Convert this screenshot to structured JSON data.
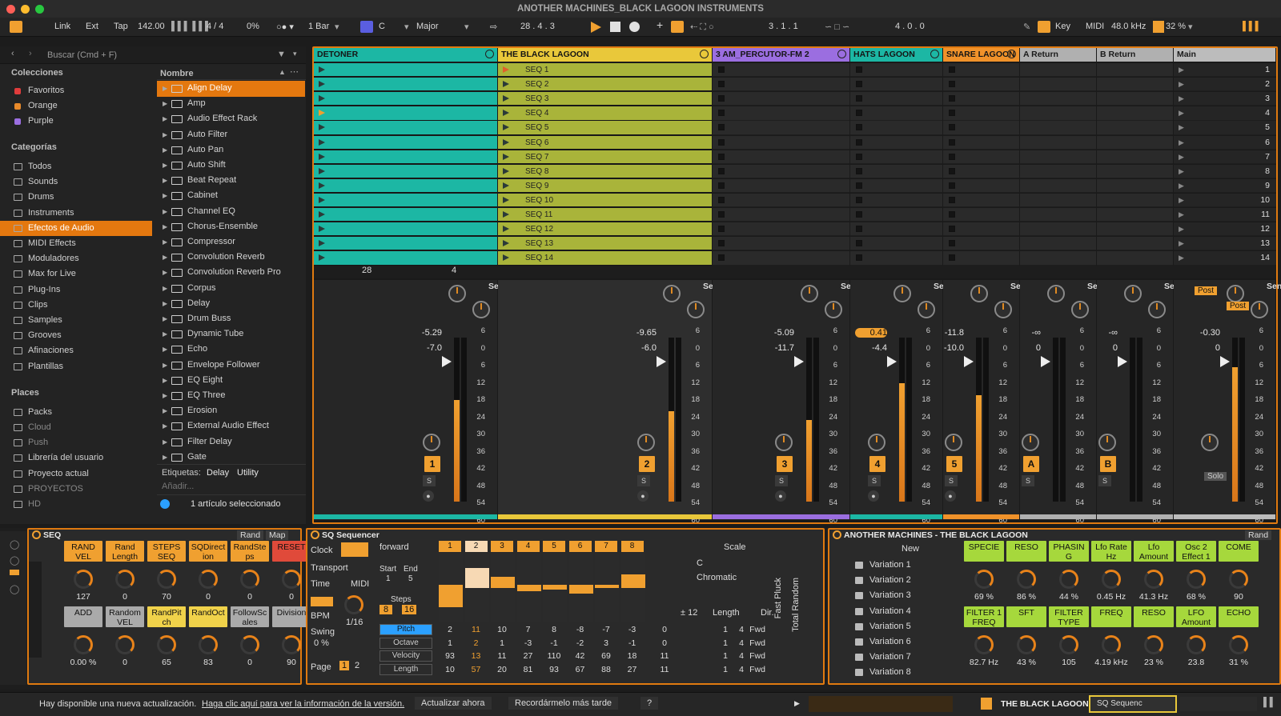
{
  "window_title": "ANOTHER MACHINES_BLACK LAGOON INSTRUMENTS",
  "transport": {
    "link": "Link",
    "ext": "Ext",
    "tap": "Tap",
    "bpm": "142.00",
    "sig": "4 / 4",
    "groove": "0%",
    "quant": "1 Bar",
    "key": "C",
    "scale": "Major",
    "position": "28 .  4 .  3",
    "loop_start": "3 .  1 .  1",
    "loop_len": "4 .  0 .  0",
    "key_label": "Key",
    "midi_label": "MIDI",
    "rate": "48.0 kHz",
    "cpu": "32 %"
  },
  "browser": {
    "search_placeholder": "Buscar (Cmd + F)",
    "collections_title": "Colecciones",
    "collections": [
      {
        "label": "Favoritos",
        "color": "#e03c3c"
      },
      {
        "label": "Orange",
        "color": "#e88a2a"
      },
      {
        "label": "Purple",
        "color": "#9b6ee0"
      }
    ],
    "categories_title": "Categorías",
    "categories": [
      "Todos",
      "Sounds",
      "Drums",
      "Instruments",
      "Efectos de Audio",
      "MIDI Effects",
      "Moduladores",
      "Max for Live",
      "Plug-Ins",
      "Clips",
      "Samples",
      "Grooves",
      "Afinaciones",
      "Plantillas"
    ],
    "places_title": "Places",
    "places": [
      "Packs",
      "Cloud",
      "Push",
      "Librería del usuario",
      "Proyecto actual",
      "PROYECTOS",
      "HD"
    ],
    "name_header": "Nombre",
    "devices": [
      "Align Delay",
      "Amp",
      "Audio Effect Rack",
      "Auto Filter",
      "Auto Pan",
      "Auto Shift",
      "Beat Repeat",
      "Cabinet",
      "Channel EQ",
      "Chorus-Ensemble",
      "Compressor",
      "Convolution Reverb",
      "Convolution Reverb Pro",
      "Corpus",
      "Delay",
      "Drum Buss",
      "Dynamic Tube",
      "Echo",
      "Envelope Follower",
      "EQ Eight",
      "EQ Three",
      "Erosion",
      "External Audio Effect",
      "Filter Delay",
      "Gate"
    ],
    "tags_label": "Etiquetas:",
    "tags": [
      "Delay",
      "Utility"
    ],
    "add_label": "Añadir...",
    "selected_count": "1 artículo seleccionado"
  },
  "tracks": [
    {
      "name": "DETONER",
      "color": "#1cb7a4",
      "vol": "-5.29",
      "vol2": "-7.0",
      "num": "1",
      "meter": 0.62
    },
    {
      "name": "THE BLACK LAGOON",
      "color": "#e9c83a",
      "vol": "-9.65",
      "vol2": "-6.0",
      "num": "2",
      "meter": 0.55
    },
    {
      "name": "3 AM_PERCUTOR-FM 2",
      "color": "#9b6ee0",
      "vol": "-5.09",
      "vol2": "-11.7",
      "num": "3",
      "meter": 0.5
    },
    {
      "name": "HATS LAGOON",
      "color": "#1cb7a4",
      "vol": "0.41",
      "vol2": "-4.4",
      "num": "4",
      "meter": 0.72
    },
    {
      "name": "SNARE LAGOON",
      "color": "#f0922a",
      "vol": "-11.8",
      "vol2": "-10.0",
      "num": "5",
      "meter": 0.65
    },
    {
      "name": "A Return",
      "color": "#b0b0b0",
      "vol": "-∞",
      "vol2": "0",
      "num": "A",
      "meter": 0
    },
    {
      "name": "B Return",
      "color": "#b0b0b0",
      "vol": "-∞",
      "vol2": "0",
      "num": "B",
      "meter": 0
    },
    {
      "name": "Main",
      "color": "#bcbcbc",
      "vol": "-0.30",
      "vol2": "0",
      "num": "",
      "meter": 0.82
    }
  ],
  "clips": [
    "SEQ 1",
    "SEQ 2",
    "SEQ 3",
    "SEQ 4",
    "SEQ 5",
    "SEQ 6",
    "SEQ 7",
    "SEQ 8",
    "SEQ 9",
    "SEQ 10",
    "SEQ 11",
    "SEQ 12",
    "SEQ 13",
    "SEQ 14"
  ],
  "scenes": [
    "1",
    "2",
    "3",
    "4",
    "5",
    "6",
    "7",
    "8",
    "9",
    "10",
    "11",
    "12",
    "13",
    "14"
  ],
  "sends_label": "Sends",
  "post_label": "Post",
  "solo_label": "Solo",
  "status1": {
    "a": "28",
    "b": "4"
  },
  "meter_scale": [
    "6",
    "0",
    "6",
    "12",
    "18",
    "24",
    "30",
    "36",
    "42",
    "48",
    "54",
    "60"
  ],
  "seq_device": {
    "title": "SEQ",
    "rand": "Rand",
    "map": "Map",
    "top_buttons": [
      "RAND VEL",
      "Rand Length",
      "STEPS SEQ",
      "SQDirect ion",
      "RandSte ps",
      "RESET"
    ],
    "top_values": [
      "127",
      "0",
      "70",
      "0",
      "0",
      "0"
    ],
    "bottom_buttons": [
      "ADD",
      "Random VEL",
      "RandPit ch",
      "RandOct",
      "FollowSc ales",
      "Division"
    ],
    "bottom_values": [
      "0.00 %",
      "0",
      "65",
      "83",
      "0",
      "90"
    ]
  },
  "sq": {
    "title": "SQ Sequencer",
    "clock": "Clock",
    "transport": "Transport",
    "time": "Time",
    "midi": "MIDI",
    "bpm": "BPM",
    "rate": "1/16",
    "swing_label": "Swing",
    "swing": "0 %",
    "page_label": "Page",
    "pages": [
      "1",
      "2"
    ],
    "direction": "forward",
    "start_label": "Start",
    "end_label": "End",
    "start": "1",
    "end": "5",
    "steps_label": "Steps",
    "steps": [
      "8",
      "16"
    ],
    "scale_label": "Scale",
    "root": "C",
    "mode": "Chromatic",
    "transpose": "± 12",
    "length_label": "Length",
    "dir_label": "Dir.",
    "step_numbers": [
      "1",
      "2",
      "3",
      "4",
      "5",
      "6",
      "7",
      "8"
    ],
    "step_levels": [
      0.22,
      0.75,
      0.62,
      0.45,
      0.48,
      0.42,
      0.5,
      0.65
    ],
    "rows": [
      {
        "label": "Pitch",
        "values": [
          "2",
          "11",
          "10",
          "7",
          "8",
          "-8",
          "-7",
          "-3"
        ],
        "extra": "0"
      },
      {
        "label": "Octave",
        "values": [
          "1",
          "2",
          "1",
          "-3",
          "-1",
          "-2",
          "3",
          "-1"
        ],
        "extra": "0"
      },
      {
        "label": "Velocity",
        "values": [
          "93",
          "13",
          "11",
          "27",
          "110",
          "42",
          "69",
          "18"
        ],
        "extra": "11"
      },
      {
        "label": "Length",
        "values": [
          "10",
          "57",
          "20",
          "81",
          "93",
          "67",
          "88",
          "27"
        ],
        "extra": "11"
      }
    ],
    "len_cols": [
      "1",
      "4",
      "Fwd"
    ],
    "fast_pluck": "Fast Pluck",
    "total_random": "Total Random"
  },
  "am": {
    "title": "ANOTHER MACHINES - THE BLACK LAGOON",
    "new": "New",
    "rand": "Rand",
    "variations": [
      "Variation 1",
      "Variation 2",
      "Variation 3",
      "Variation 4",
      "Variation 5",
      "Variation 6",
      "Variation 7",
      "Variation 8"
    ],
    "top": [
      {
        "l": "SPECIE",
        "v": "69 %"
      },
      {
        "l": "RESO",
        "v": "86 %"
      },
      {
        "l": "PHASIN G",
        "v": "44 %"
      },
      {
        "l": "Lfo Rate Hz",
        "v": "0.45 Hz"
      },
      {
        "l": "Lfo Amount",
        "v": "41.3 Hz"
      },
      {
        "l": "Osc 2 Effect 1",
        "v": "68 %"
      },
      {
        "l": "COME",
        "v": "90"
      }
    ],
    "bottom": [
      {
        "l": "FILTER 1 FREQ",
        "v": "82.7 Hz"
      },
      {
        "l": "SFT",
        "v": "43 %"
      },
      {
        "l": "FILTER TYPE",
        "v": "105"
      },
      {
        "l": "FREQ",
        "v": "4.19 kHz"
      },
      {
        "l": "RESO",
        "v": "23 %"
      },
      {
        "l": "LFO Amount",
        "v": "23.8"
      },
      {
        "l": "ECHO",
        "v": "31 %"
      }
    ]
  },
  "status": {
    "msg": "Hay disponible una nueva actualización.",
    "link": "Haga clic aquí para ver la información de la versión.",
    "update": "Actualizar ahora",
    "later": "Recordármelo más tarde",
    "q": "?",
    "track": "THE BLACK LAGOON",
    "device": "SQ Sequenc"
  }
}
